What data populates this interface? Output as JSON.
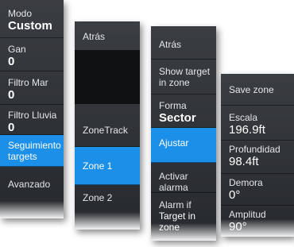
{
  "menu1": {
    "items": [
      {
        "label": "Modo",
        "value": "Custom"
      },
      {
        "label": "Gan",
        "value": "0"
      },
      {
        "label": "Filtro Mar",
        "value": "0"
      },
      {
        "label": "Filtro Lluvia",
        "value": "0"
      },
      {
        "label": "Seguimiento targets"
      },
      {
        "label": "Avanzado"
      }
    ]
  },
  "menu2": {
    "items": [
      {
        "label": "Atrás"
      },
      {
        "label": "ZoneTrack"
      },
      {
        "label": "Zone 1"
      },
      {
        "label": "Zone 2"
      }
    ]
  },
  "menu3": {
    "items": [
      {
        "label": "Atrás"
      },
      {
        "label": "Show target in zone"
      },
      {
        "label": "Forma",
        "value": "Sector"
      },
      {
        "label": "Ajustar"
      },
      {
        "label": "Activar alarma"
      },
      {
        "label": "Alarm if",
        "value": "Target in zone"
      }
    ]
  },
  "menu4": {
    "items": [
      {
        "label": "Save zone"
      },
      {
        "label": "Escala",
        "value": "196.9ft"
      },
      {
        "label": "Profundidad",
        "value": "98.4ft"
      },
      {
        "label": "Demora",
        "value": "0°"
      },
      {
        "label": "Amplitud",
        "value": "90°"
      }
    ]
  },
  "colors": {
    "menu_bg": "#2f3236",
    "selected": "#1c8fe8",
    "text": "#ffffff"
  }
}
